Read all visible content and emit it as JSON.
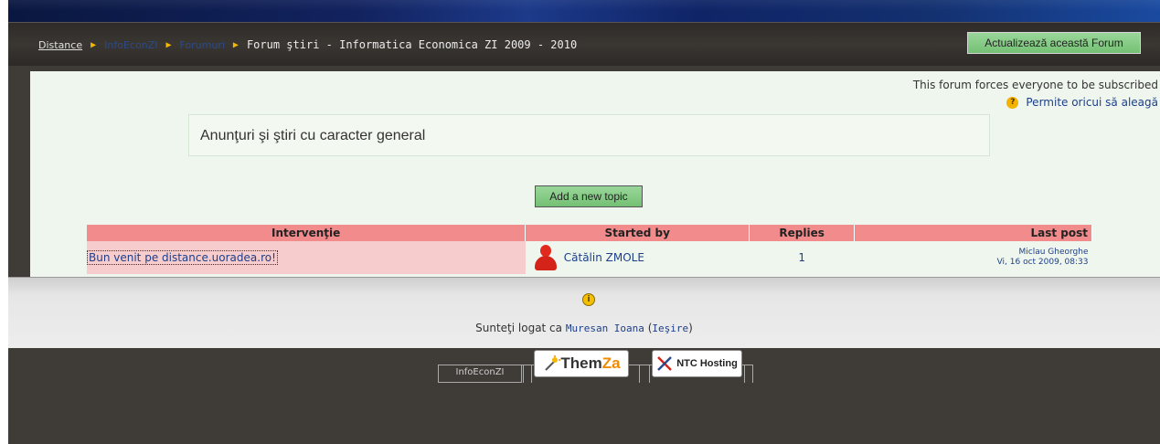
{
  "breadcrumb": {
    "items": [
      "Distance",
      "InfoEconZI",
      "Forumuri"
    ],
    "current": "Forum ştiri - Informatica Economica ZI 2009 - 2010"
  },
  "header": {
    "update_button": "Actualizează această Forum"
  },
  "subscription": {
    "note": "This forum forces everyone to be subscribed",
    "permit_link": "Permite oricui să aleagă"
  },
  "intro": {
    "text": "Anunţuri şi ştiri cu caracter general"
  },
  "actions": {
    "add_topic": "Add a new topic"
  },
  "table": {
    "headers": [
      "Intervenţie",
      "Started by",
      "Replies",
      "Last post"
    ],
    "rows": [
      {
        "topic": "Bun venit pe distance.uoradea.ro!",
        "started_by": "Cătălin ZMOLE",
        "replies": "1",
        "last_post_author": "Miclau Gheorghe",
        "last_post_date": "Vi, 16 oct 2009, 08:33"
      }
    ]
  },
  "footer": {
    "logged_prefix": "Sunteţi logat ca ",
    "user": "Muresan Ioana",
    "logout": "Ieşire",
    "tab_label": "InfoEconZI",
    "themza_part1": "Them",
    "themza_part2": "Za",
    "ntc_label": "NTC Hosting"
  },
  "colors": {
    "accent_green": "#82c882",
    "table_header": "#f28b8b",
    "row_highlight": "#f7cccc"
  },
  "icons": {
    "breadcrumb_separator": "triangle-right-icon",
    "help": "help-icon",
    "info": "info-icon",
    "user": "user-icon"
  }
}
